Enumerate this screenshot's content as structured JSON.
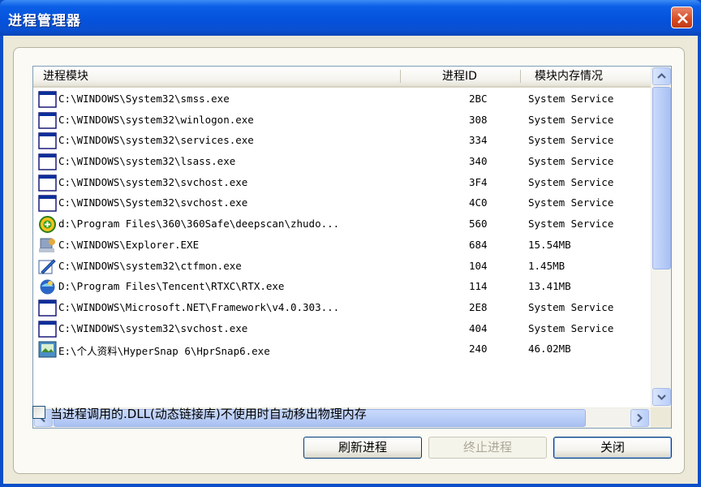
{
  "window": {
    "title": "进程管理器"
  },
  "table": {
    "columns": [
      "进程模块",
      "进程ID",
      "模块内存情况"
    ],
    "rows": [
      {
        "icon": "window-icon",
        "path": "C:\\WINDOWS\\System32\\smss.exe",
        "pid": "2BC",
        "mem": "System Service"
      },
      {
        "icon": "window-icon",
        "path": "C:\\WINDOWS\\system32\\winlogon.exe",
        "pid": "308",
        "mem": "System Service"
      },
      {
        "icon": "window-icon",
        "path": "C:\\WINDOWS\\system32\\services.exe",
        "pid": "334",
        "mem": "System Service"
      },
      {
        "icon": "window-icon",
        "path": "C:\\WINDOWS\\system32\\lsass.exe",
        "pid": "340",
        "mem": "System Service"
      },
      {
        "icon": "window-icon",
        "path": "C:\\WINDOWS\\system32\\svchost.exe",
        "pid": "3F4",
        "mem": "System Service"
      },
      {
        "icon": "window-icon",
        "path": "C:\\WINDOWS\\System32\\svchost.exe",
        "pid": "4C0",
        "mem": "System Service"
      },
      {
        "icon": "360-icon",
        "path": "d:\\Program Files\\360\\360Safe\\deepscan\\zhudo...",
        "pid": "560",
        "mem": "System Service"
      },
      {
        "icon": "explorer-icon",
        "path": "C:\\WINDOWS\\Explorer.EXE",
        "pid": "684",
        "mem": "15.54MB"
      },
      {
        "icon": "ctfmon-icon",
        "path": "C:\\WINDOWS\\system32\\ctfmon.exe",
        "pid": "104",
        "mem": " 1.45MB"
      },
      {
        "icon": "rtx-icon",
        "path": "D:\\Program Files\\Tencent\\RTXC\\RTX.exe",
        "pid": "114",
        "mem": "13.41MB"
      },
      {
        "icon": "window-icon",
        "path": "C:\\WINDOWS\\Microsoft.NET\\Framework\\v4.0.303...",
        "pid": "2E8",
        "mem": "System Service"
      },
      {
        "icon": "window-icon",
        "path": "C:\\WINDOWS\\system32\\svchost.exe",
        "pid": "404",
        "mem": "System Service"
      },
      {
        "icon": "hypersnap-icon",
        "path": "E:\\个人资料\\HyperSnap 6\\HprSnap6.exe",
        "pid": "240",
        "mem": "46.02MB"
      }
    ]
  },
  "option": {
    "label": "当进程调用的.DLL(动态链接库)不使用时自动移出物理内存",
    "checked": false
  },
  "buttons": {
    "refresh": "刷新进程",
    "terminate": "终止进程",
    "close": "关闭"
  }
}
